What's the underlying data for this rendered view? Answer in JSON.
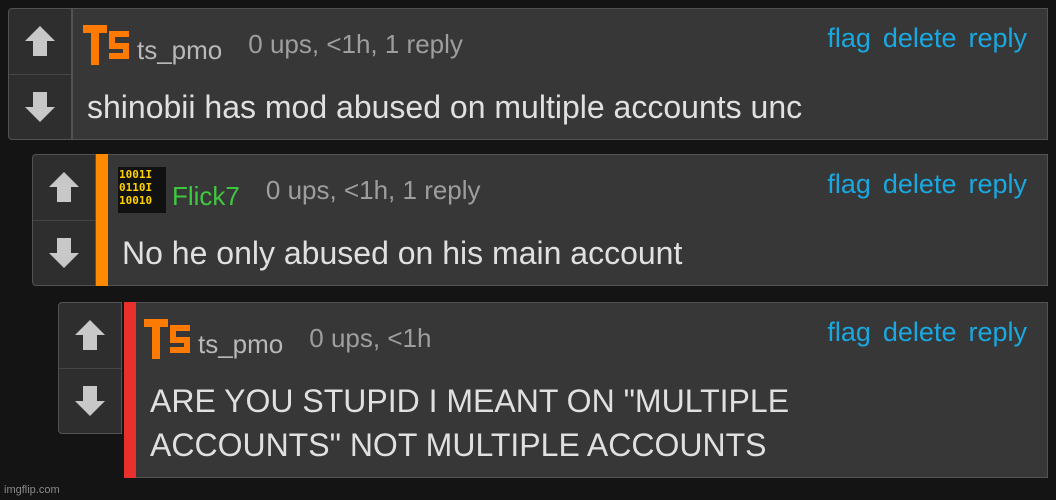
{
  "comments": [
    {
      "username": "ts_pmo",
      "avatar_icon": "ts-logo-icon",
      "meta": "0 ups, <1h, 1 reply",
      "text": "shinobii has mod abused on multiple accounts unc",
      "depth_color": "",
      "actions": {
        "flag": "flag",
        "delete": "delete",
        "reply": "reply"
      }
    },
    {
      "username": "Flick7",
      "avatar_icon": "binary-pixel-icon",
      "meta": "0 ups, <1h, 1 reply",
      "text": "No he only abused on his main account",
      "depth_color": "#ff8a00",
      "actions": {
        "flag": "flag",
        "delete": "delete",
        "reply": "reply"
      }
    },
    {
      "username": "ts_pmo",
      "avatar_icon": "ts-logo-icon",
      "meta": "0 ups, <1h",
      "text": "ARE YOU STUPID I MEANT ON \"MULTIPLE\nACCOUNTS\" NOT MULTIPLE ACCOUNTS",
      "depth_color": "#e8302c",
      "actions": {
        "flag": "flag",
        "delete": "delete",
        "reply": "reply"
      }
    }
  ],
  "colors": {
    "link": "#1aa8e0",
    "username_green": "#3fc83f",
    "logo_orange": "#ff7a00"
  },
  "watermark": "imgflip.com"
}
